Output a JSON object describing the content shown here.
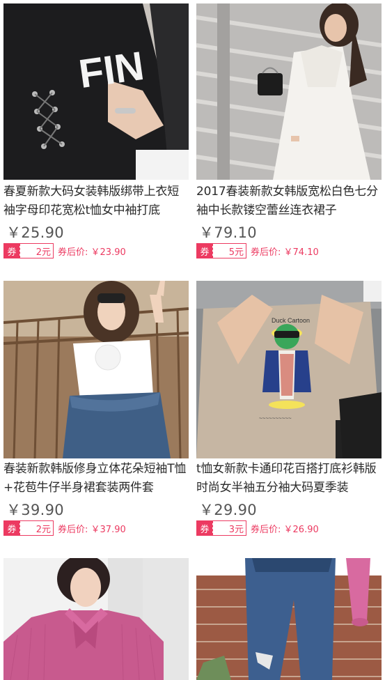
{
  "currency": "￥",
  "coupon_label": "券",
  "after_coupon_label": "券后价:",
  "products": [
    {
      "title": "春夏新款大码女装韩版绑带上衣短袖字母印花宽松t恤女中袖打底",
      "price": "￥25.90",
      "coupon": "2元",
      "after_price": "￥23.90"
    },
    {
      "title": "2017春装新款女韩版宽松白色七分袖中长款镂空蕾丝连衣裙子",
      "price": "￥79.10",
      "coupon": "5元",
      "after_price": "￥74.10"
    },
    {
      "title": "春装新款韩版修身立体花朵短袖T恤+花苞牛仔半身裙套装两件套",
      "price": "￥39.90",
      "coupon": "2元",
      "after_price": "￥37.90"
    },
    {
      "title": "t恤女新款卡通印花百搭打底衫韩版时尚女半袖五分袖大码夏季装",
      "price": "￥29.90",
      "coupon": "3元",
      "after_price": "￥26.90"
    }
  ],
  "images": [
    {
      "icon": "black-lace-up-tee-photo",
      "text": "FIN"
    },
    {
      "icon": "white-lace-dress-photo"
    },
    {
      "icon": "white-top-denim-skirt-photo"
    },
    {
      "icon": "duck-print-tee-photo",
      "text": "Duck Cartoon"
    },
    {
      "icon": "pink-bow-blouse-photo"
    },
    {
      "icon": "ripped-jeans-photo"
    }
  ]
}
